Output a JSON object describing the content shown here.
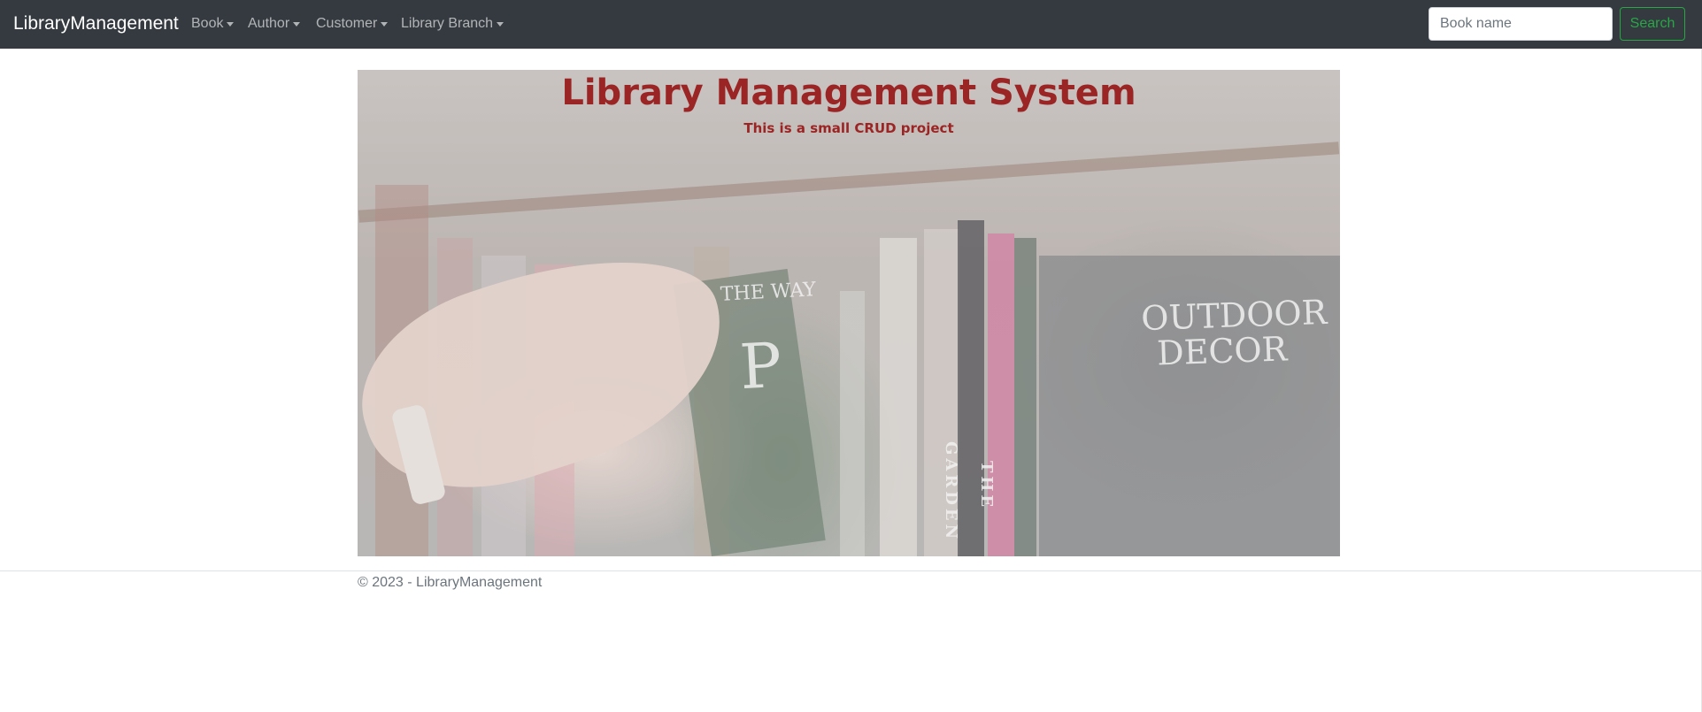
{
  "navbar": {
    "brand": "LibraryManagement",
    "items": [
      {
        "label": "Book"
      },
      {
        "label": "Author"
      },
      {
        "label": "Customer"
      },
      {
        "label": "Library Branch"
      }
    ],
    "search": {
      "placeholder": "Book name",
      "value": "",
      "button_label": "Search"
    }
  },
  "hero": {
    "title": "Library Management System",
    "subtitle": "This is a small CRUD project",
    "image_text": {
      "cover_left": "THE WAY",
      "cover_letter": "P",
      "spine_garden": "THE GARDEN",
      "cover_right": "OUTDOOR DECOR"
    }
  },
  "footer": {
    "text": "© 2023 - LibraryManagement"
  },
  "colors": {
    "navbar_bg": "#343a40",
    "title_color": "#9b2424",
    "search_button": "#28a745"
  }
}
